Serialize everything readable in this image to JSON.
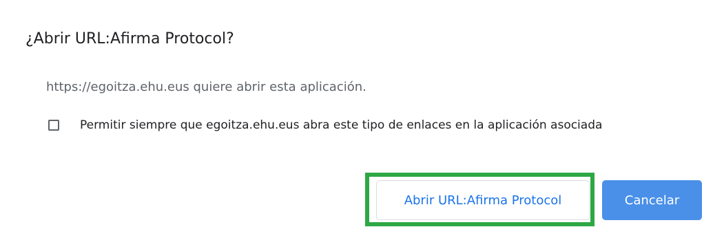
{
  "dialog": {
    "title": "¿Abrir URL:Afirma Protocol?",
    "message": "https://egoitza.ehu.eus quiere abrir esta aplicación.",
    "checkbox": {
      "label": "Permitir siempre que egoitza.ehu.eus abra este tipo de enlaces en la aplicación asociada",
      "checked": false
    },
    "buttons": {
      "open_label": "Abrir URL:Afirma Protocol",
      "cancel_label": "Cancelar"
    }
  },
  "colors": {
    "primary_blue": "#4a90e8",
    "link_blue": "#1a73e8",
    "highlight_green": "#2ea745"
  }
}
